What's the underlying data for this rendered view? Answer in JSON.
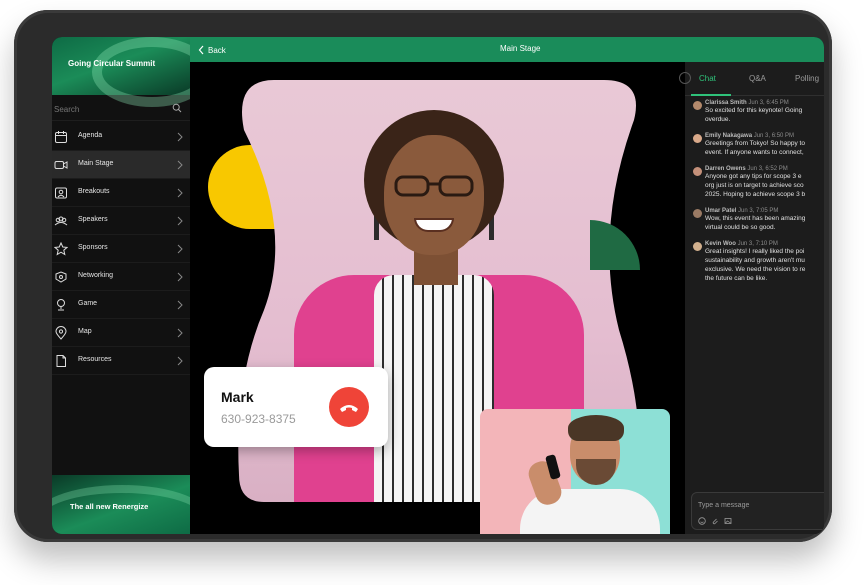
{
  "sidebar": {
    "title": "Going Circular Summit",
    "search_placeholder": "Search",
    "items": [
      {
        "label": "Agenda",
        "icon": "calendar-icon"
      },
      {
        "label": "Main Stage",
        "icon": "video-icon"
      },
      {
        "label": "Breakouts",
        "icon": "breakout-room-icon"
      },
      {
        "label": "Speakers",
        "icon": "speakers-icon"
      },
      {
        "label": "Sponsors",
        "icon": "star-icon"
      },
      {
        "label": "Networking",
        "icon": "networking-icon"
      },
      {
        "label": "Game",
        "icon": "trophy-icon"
      },
      {
        "label": "Map",
        "icon": "map-pin-icon"
      },
      {
        "label": "Resources",
        "icon": "document-icon"
      }
    ],
    "active_item": "Main Stage",
    "footer_text": "The all new Renergize"
  },
  "topbar": {
    "back_label": "Back",
    "title": "Main Stage"
  },
  "stage": {
    "call": {
      "name": "Mark",
      "number": "630-923-8375"
    }
  },
  "chat": {
    "tabs": [
      {
        "label": "Chat",
        "active": true
      },
      {
        "label": "Q&A",
        "active": false
      },
      {
        "label": "Polling",
        "active": false
      }
    ],
    "messages": [
      {
        "author": "Clarissa Smith",
        "time": "Jun 3, 6:45 PM",
        "text": "So excited for this keynote! Going\noverdue."
      },
      {
        "author": "Emily Nakagawa",
        "time": "Jun 3, 6:50 PM",
        "text": "Greetings from Tokyo! So happy to\nevent. If anyone wants to connect,"
      },
      {
        "author": "Darren Owens",
        "time": "Jun 3, 6:52 PM",
        "text": "Anyone got any tips for scope 3 e\norg just is on target to achieve sco\n2025. Hoping to achieve scope 3 b"
      },
      {
        "author": "Umar Patel",
        "time": "Jun 3, 7:05 PM",
        "text": "Wow, this event has been amazing\nvirtual could be so good."
      },
      {
        "author": "Kevin Woo",
        "time": "Jun 3, 7:10 PM",
        "text": "Great insights! I really liked the poi\nsustainability and growth aren't mu\nexclusive. We need the vision to re\nthe future can be like."
      }
    ],
    "composer_placeholder": "Type a message"
  },
  "colors": {
    "brand_green": "#1a8c5a",
    "accent_green": "#2fc27a",
    "hangup_red": "#ef4438",
    "shape_yellow": "#f8c800"
  }
}
